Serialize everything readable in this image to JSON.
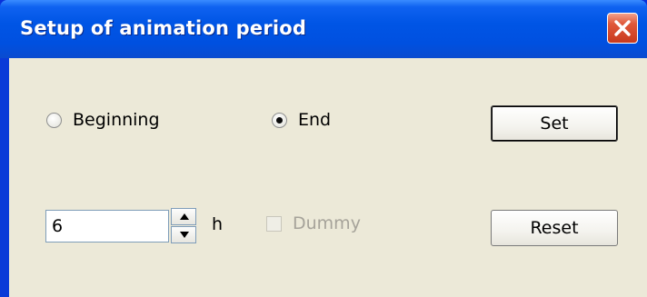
{
  "window": {
    "title": "Setup of animation period",
    "close_icon": "close-icon",
    "colors": {
      "titlebar": "#0055e5",
      "close": "#d9532f",
      "face": "#ece9d8"
    }
  },
  "period": {
    "options": [
      {
        "label": "Beginning",
        "checked": false
      },
      {
        "label": "End",
        "checked": true
      }
    ]
  },
  "buttons": {
    "set_label": "Set",
    "reset_label": "Reset"
  },
  "duration": {
    "value": "6",
    "unit": "h"
  },
  "dummy": {
    "label": "Dummy",
    "checked": false,
    "enabled": false
  }
}
